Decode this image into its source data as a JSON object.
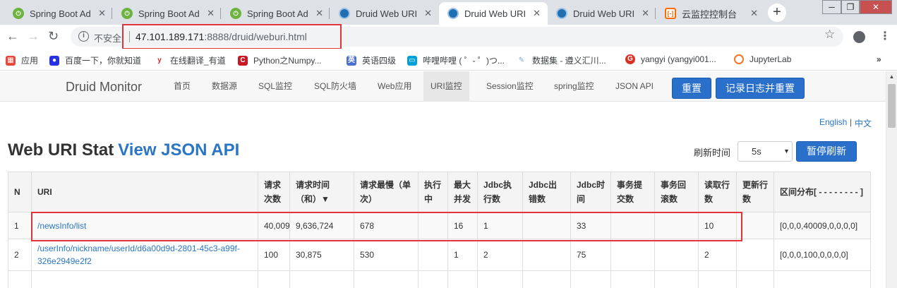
{
  "browser": {
    "tabs": [
      {
        "title": "Spring Boot Ad",
        "icon": "spring-icon",
        "active": false
      },
      {
        "title": "Spring Boot Ad",
        "icon": "spring-icon",
        "active": false
      },
      {
        "title": "Spring Boot Ad",
        "icon": "spring-icon",
        "active": false
      },
      {
        "title": "Druid Web URI",
        "icon": "druid-icon",
        "active": false
      },
      {
        "title": "Druid Web URI",
        "icon": "druid-icon",
        "active": true
      },
      {
        "title": "Druid Web URI",
        "icon": "druid-icon",
        "active": false
      },
      {
        "title": "云监控控制台",
        "icon": "cloud-icon",
        "active": false
      }
    ],
    "security_label": "不安全",
    "url_host": "47.101.189.171",
    "url_path": ":8888/druid/weburi.html",
    "bookmarks": [
      {
        "label": "应用",
        "icon": "apps-icon",
        "color": "#e8453c"
      },
      {
        "label": "百度一下，你就知道",
        "icon": "baidu-icon",
        "color": "#2932e1"
      },
      {
        "label": "在线翻译_有道",
        "icon": "youdao-icon",
        "color": "#e02020"
      },
      {
        "label": "Python之Numpy...",
        "icon": "csdn-icon",
        "color": "#c81623"
      },
      {
        "label": "英语四级",
        "icon": "book-icon",
        "color": "#4a6fd1"
      },
      {
        "label": "哔哩哔哩 ( ゜- ゜)つ...",
        "icon": "bilibili-icon",
        "color": "#00a1d6"
      },
      {
        "label": "数据集 - 遵义汇川...",
        "icon": "data-icon",
        "color": "#7aa7d8"
      },
      {
        "label": "yangyi (yangyi001...",
        "icon": "github-icon",
        "color": "#d93025"
      },
      {
        "label": "JupyterLab",
        "icon": "jupyter-icon",
        "color": "#f37726"
      }
    ]
  },
  "druid": {
    "brand": "Druid Monitor",
    "nav": [
      "首页",
      "数据源",
      "SQL监控",
      "SQL防火墙",
      "Web应用",
      "URI监控",
      "Session监控",
      "spring监控",
      "JSON API"
    ],
    "active_nav": "URI监控",
    "reset_label": "重置",
    "log_reset_label": "记录日志并重置",
    "lang_en": "English",
    "lang_sep": "|",
    "lang_zh": "中文",
    "heading": "Web URI Stat",
    "heading_link": "View JSON API",
    "refresh_label": "刷新时间",
    "refresh_value": "5s",
    "pause_label": "暂停刷新"
  },
  "table": {
    "headers": [
      "N",
      "URI",
      "请求次数",
      "请求时间（和）▼",
      "请求最慢（单次）",
      "执行中",
      "最大并发",
      "Jdbc执行数",
      "Jdbc出错数",
      "Jdbc时间",
      "事务提交数",
      "事务回滚数",
      "读取行数",
      "更新行数",
      "区间分布[ - - - - - - - - ]"
    ],
    "rows": [
      [
        "1",
        "/newsInfo/list",
        "40,009",
        "9,636,724",
        "678",
        "",
        "16",
        "1",
        "",
        "33",
        "",
        "",
        "10",
        "",
        "[0,0,0,40009,0,0,0,0]"
      ],
      [
        "2",
        "/userInfo/nickname/userId/d6a00d9d-2801-45c3-a99f-326e2949e2f2",
        "100",
        "30,875",
        "530",
        "",
        "1",
        "2",
        "",
        "75",
        "",
        "",
        "2",
        "",
        "[0,0,0,100,0,0,0,0]"
      ]
    ]
  }
}
